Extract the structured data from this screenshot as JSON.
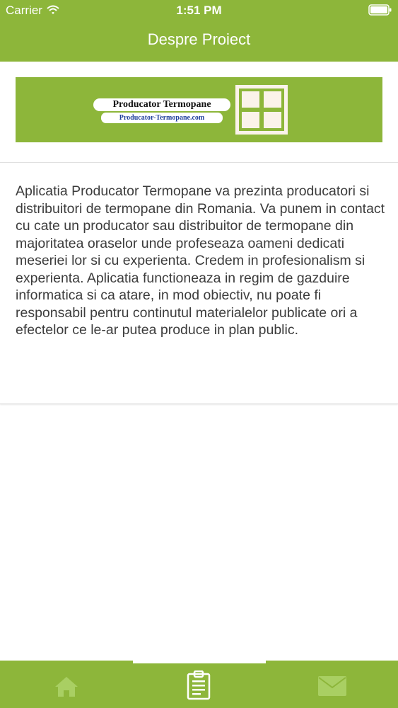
{
  "status_bar": {
    "carrier": "Carrier",
    "time": "1:51 PM"
  },
  "header": {
    "title": "Despre Proiect"
  },
  "banner": {
    "logo_title": "Producator Termopane",
    "logo_url": "Producator-Termopane.com"
  },
  "content": {
    "text": "Aplicatia Producator Termopane va prezinta producatori si distribuitori de termopane din Romania. Va punem in contact cu cate un producator sau distribuitor de termopane din majoritatea oraselor unde profeseaza oameni dedicati meseriei lor si cu experienta. Credem in profesionalism si experienta.  Aplicatia functioneaza in regim de gazduire informatica si ca atare, in mod obiectiv, nu poate fi responsabil pentru continutul materialelor publicate ori a efectelor ce le-ar putea produce in plan public."
  },
  "tabbar": {
    "tabs": [
      {
        "icon": "home-icon",
        "selected": false
      },
      {
        "icon": "clipboard-icon",
        "selected": true
      },
      {
        "icon": "envelope-icon",
        "selected": false
      }
    ]
  },
  "colors": {
    "accent": "#8db63a",
    "tab_icon": "#a9cf63",
    "text": "#3c3c3c"
  }
}
